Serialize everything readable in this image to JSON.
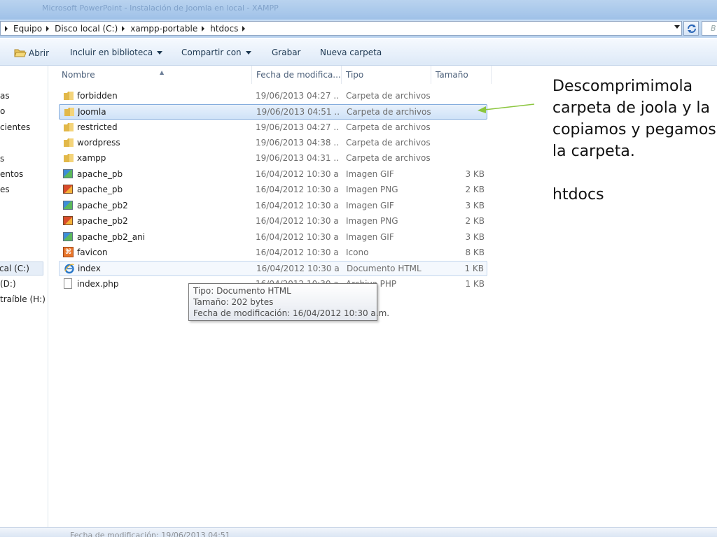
{
  "window": {
    "title": "Microsoft PowerPoint - Instalación de Joomla en local - XAMPP"
  },
  "address": {
    "crumbs": [
      "Equipo",
      "Disco local (C:)",
      "xampp-portable",
      "htdocs"
    ],
    "search_placeholder": "B"
  },
  "toolbar": {
    "open": "Abrir",
    "include": "Incluir en biblioteca",
    "share": "Compartir con",
    "burn": "Grabar",
    "new_folder": "Nueva carpeta"
  },
  "nav": {
    "items": [
      "as",
      "o",
      "cientes",
      "s",
      "entos",
      "es",
      "cal (C:)",
      "(D:)",
      "traíble (H:)"
    ]
  },
  "columns": {
    "name": "Nombre",
    "date": "Fecha de modifica...",
    "type": "Tipo",
    "size": "Tamaño"
  },
  "files": [
    {
      "name": "forbidden",
      "date": "19/06/2013 04:27 ...",
      "type": "Carpeta de archivos",
      "size": "",
      "icon": "folder-icon"
    },
    {
      "name": "Joomla",
      "date": "19/06/2013 04:51 ...",
      "type": "Carpeta de archivos",
      "size": "",
      "icon": "folder-icon"
    },
    {
      "name": "restricted",
      "date": "19/06/2013 04:27 ...",
      "type": "Carpeta de archivos",
      "size": "",
      "icon": "folder-icon"
    },
    {
      "name": "wordpress",
      "date": "19/06/2013 04:38 ...",
      "type": "Carpeta de archivos",
      "size": "",
      "icon": "folder-icon"
    },
    {
      "name": "xampp",
      "date": "19/06/2013 04:31 ...",
      "type": "Carpeta de archivos",
      "size": "",
      "icon": "folder-icon"
    },
    {
      "name": "apache_pb",
      "date": "16/04/2012 10:30 a...",
      "type": "Imagen GIF",
      "size": "3 KB",
      "icon": "gif-image-icon"
    },
    {
      "name": "apache_pb",
      "date": "16/04/2012 10:30 a...",
      "type": "Imagen PNG",
      "size": "2 KB",
      "icon": "png-image-icon"
    },
    {
      "name": "apache_pb2",
      "date": "16/04/2012 10:30 a...",
      "type": "Imagen GIF",
      "size": "3 KB",
      "icon": "gif-image-icon"
    },
    {
      "name": "apache_pb2",
      "date": "16/04/2012 10:30 a...",
      "type": "Imagen PNG",
      "size": "2 KB",
      "icon": "png-image-icon"
    },
    {
      "name": "apache_pb2_ani",
      "date": "16/04/2012 10:30 a...",
      "type": "Imagen GIF",
      "size": "3 KB",
      "icon": "gif-image-icon"
    },
    {
      "name": "favicon",
      "date": "16/04/2012 10:30 a...",
      "type": "Icono",
      "size": "8 KB",
      "icon": "xampp-icon"
    },
    {
      "name": "index",
      "date": "16/04/2012 10:30 a...",
      "type": "Documento HTML",
      "size": "1 KB",
      "icon": "ie-html-icon"
    },
    {
      "name": "index.php",
      "date": "16/04/2012 10:30 a...",
      "type": "Archivo PHP",
      "size": "1 KB",
      "icon": "document-icon"
    }
  ],
  "tooltip": {
    "type": "Tipo: Documento HTML",
    "size": "Tamaño: 202 bytes",
    "modified": "Fecha de modificación: 16/04/2012 10:30 a.m."
  },
  "annotation": {
    "lines": [
      "Descomprimimola",
      "carpeta de joola y la",
      "copiamos y pegamos",
      "la carpeta."
    ],
    "folder": "htdocs"
  },
  "status": {
    "text": "Fecha de modificación: 19/06/2013 04:51"
  },
  "colors": {
    "accent": "#84acdd",
    "arrow": "#8cc63f"
  }
}
